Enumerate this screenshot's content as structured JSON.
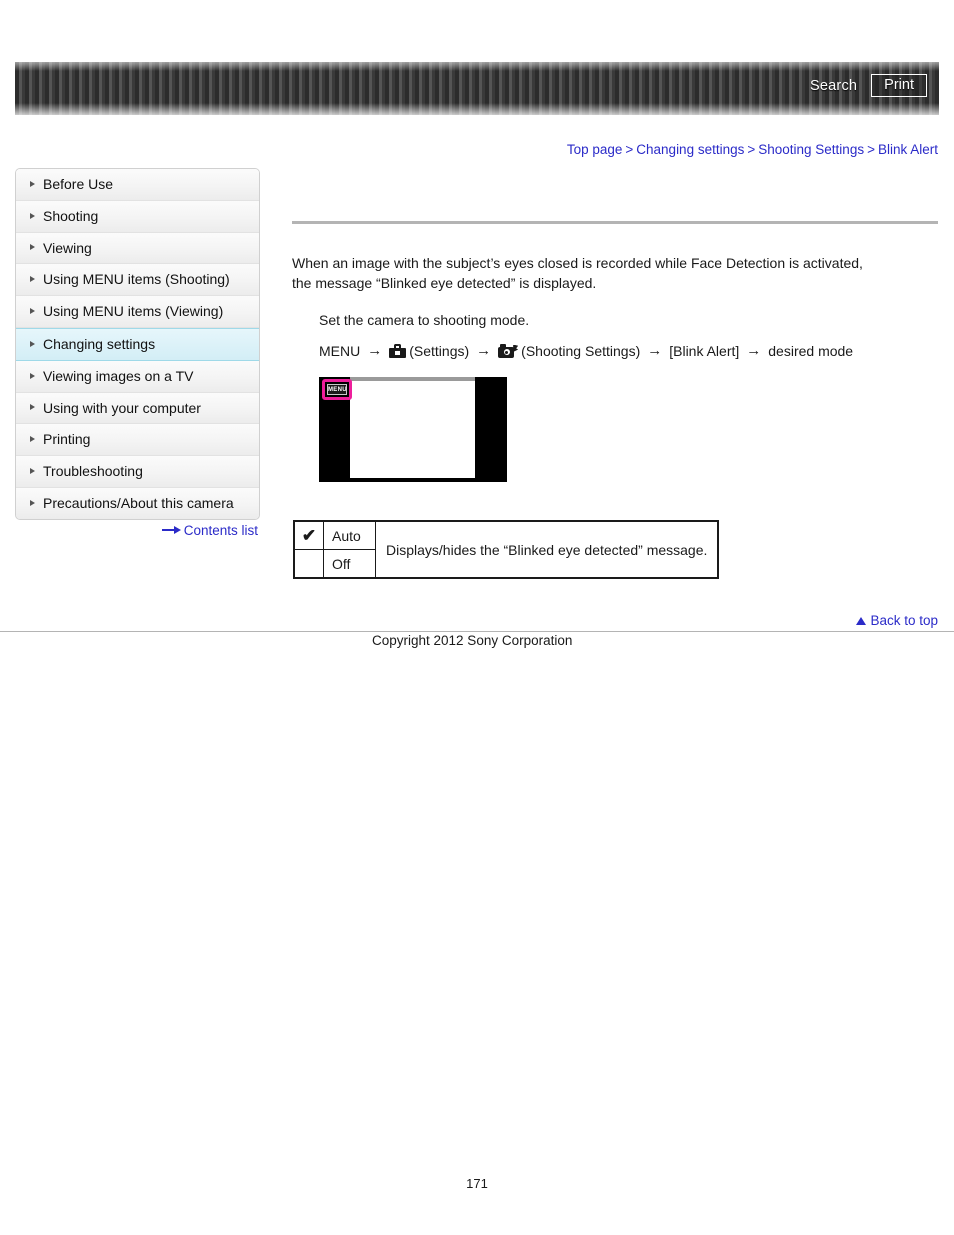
{
  "header": {
    "search_label": "Search",
    "print_label": "Print"
  },
  "breadcrumb": {
    "items": [
      {
        "label": "Top page"
      },
      {
        "label": "Changing settings"
      },
      {
        "label": "Shooting Settings"
      },
      {
        "label": "Blink Alert"
      }
    ],
    "separator": ">"
  },
  "sidebar": {
    "items": [
      {
        "label": "Before Use",
        "active": false
      },
      {
        "label": "Shooting",
        "active": false
      },
      {
        "label": "Viewing",
        "active": false
      },
      {
        "label": "Using MENU items (Shooting)",
        "active": false
      },
      {
        "label": "Using MENU items (Viewing)",
        "active": false
      },
      {
        "label": "Changing settings",
        "active": true
      },
      {
        "label": "Viewing images on a TV",
        "active": false
      },
      {
        "label": "Using with your computer",
        "active": false
      },
      {
        "label": "Printing",
        "active": false
      },
      {
        "label": "Troubleshooting",
        "active": false
      },
      {
        "label": "Precautions/About this camera",
        "active": false
      }
    ],
    "contents_list_label": "Contents list"
  },
  "main": {
    "intro": "When an image with the subject’s eyes closed is recorded while Face Detection is activated, the message “Blinked eye detected” is displayed.",
    "step": "Set the camera to shooting mode.",
    "menu_path": {
      "menu_label": "MENU",
      "arrow": "→",
      "settings_label": "(Settings)",
      "shooting_settings_label": "(Shooting Settings)",
      "item_label": "[Blink Alert]",
      "result_label": "desired mode"
    },
    "camera_screen": {
      "menu_button_label": "MENU"
    },
    "options_table": {
      "rows": [
        {
          "mark": "✔",
          "name": "Auto"
        },
        {
          "mark": "",
          "name": "Off"
        }
      ],
      "description": "Displays/hides the “Blinked eye detected” message."
    }
  },
  "footer": {
    "back_to_top_label": "Back to top",
    "copyright": "Copyright 2012 Sony Corporation",
    "page_number": "171"
  },
  "colors": {
    "link_blue": "#2b2bc8",
    "highlight_pink": "#ee1e9c",
    "sidebar_active": "#d3eef6"
  }
}
